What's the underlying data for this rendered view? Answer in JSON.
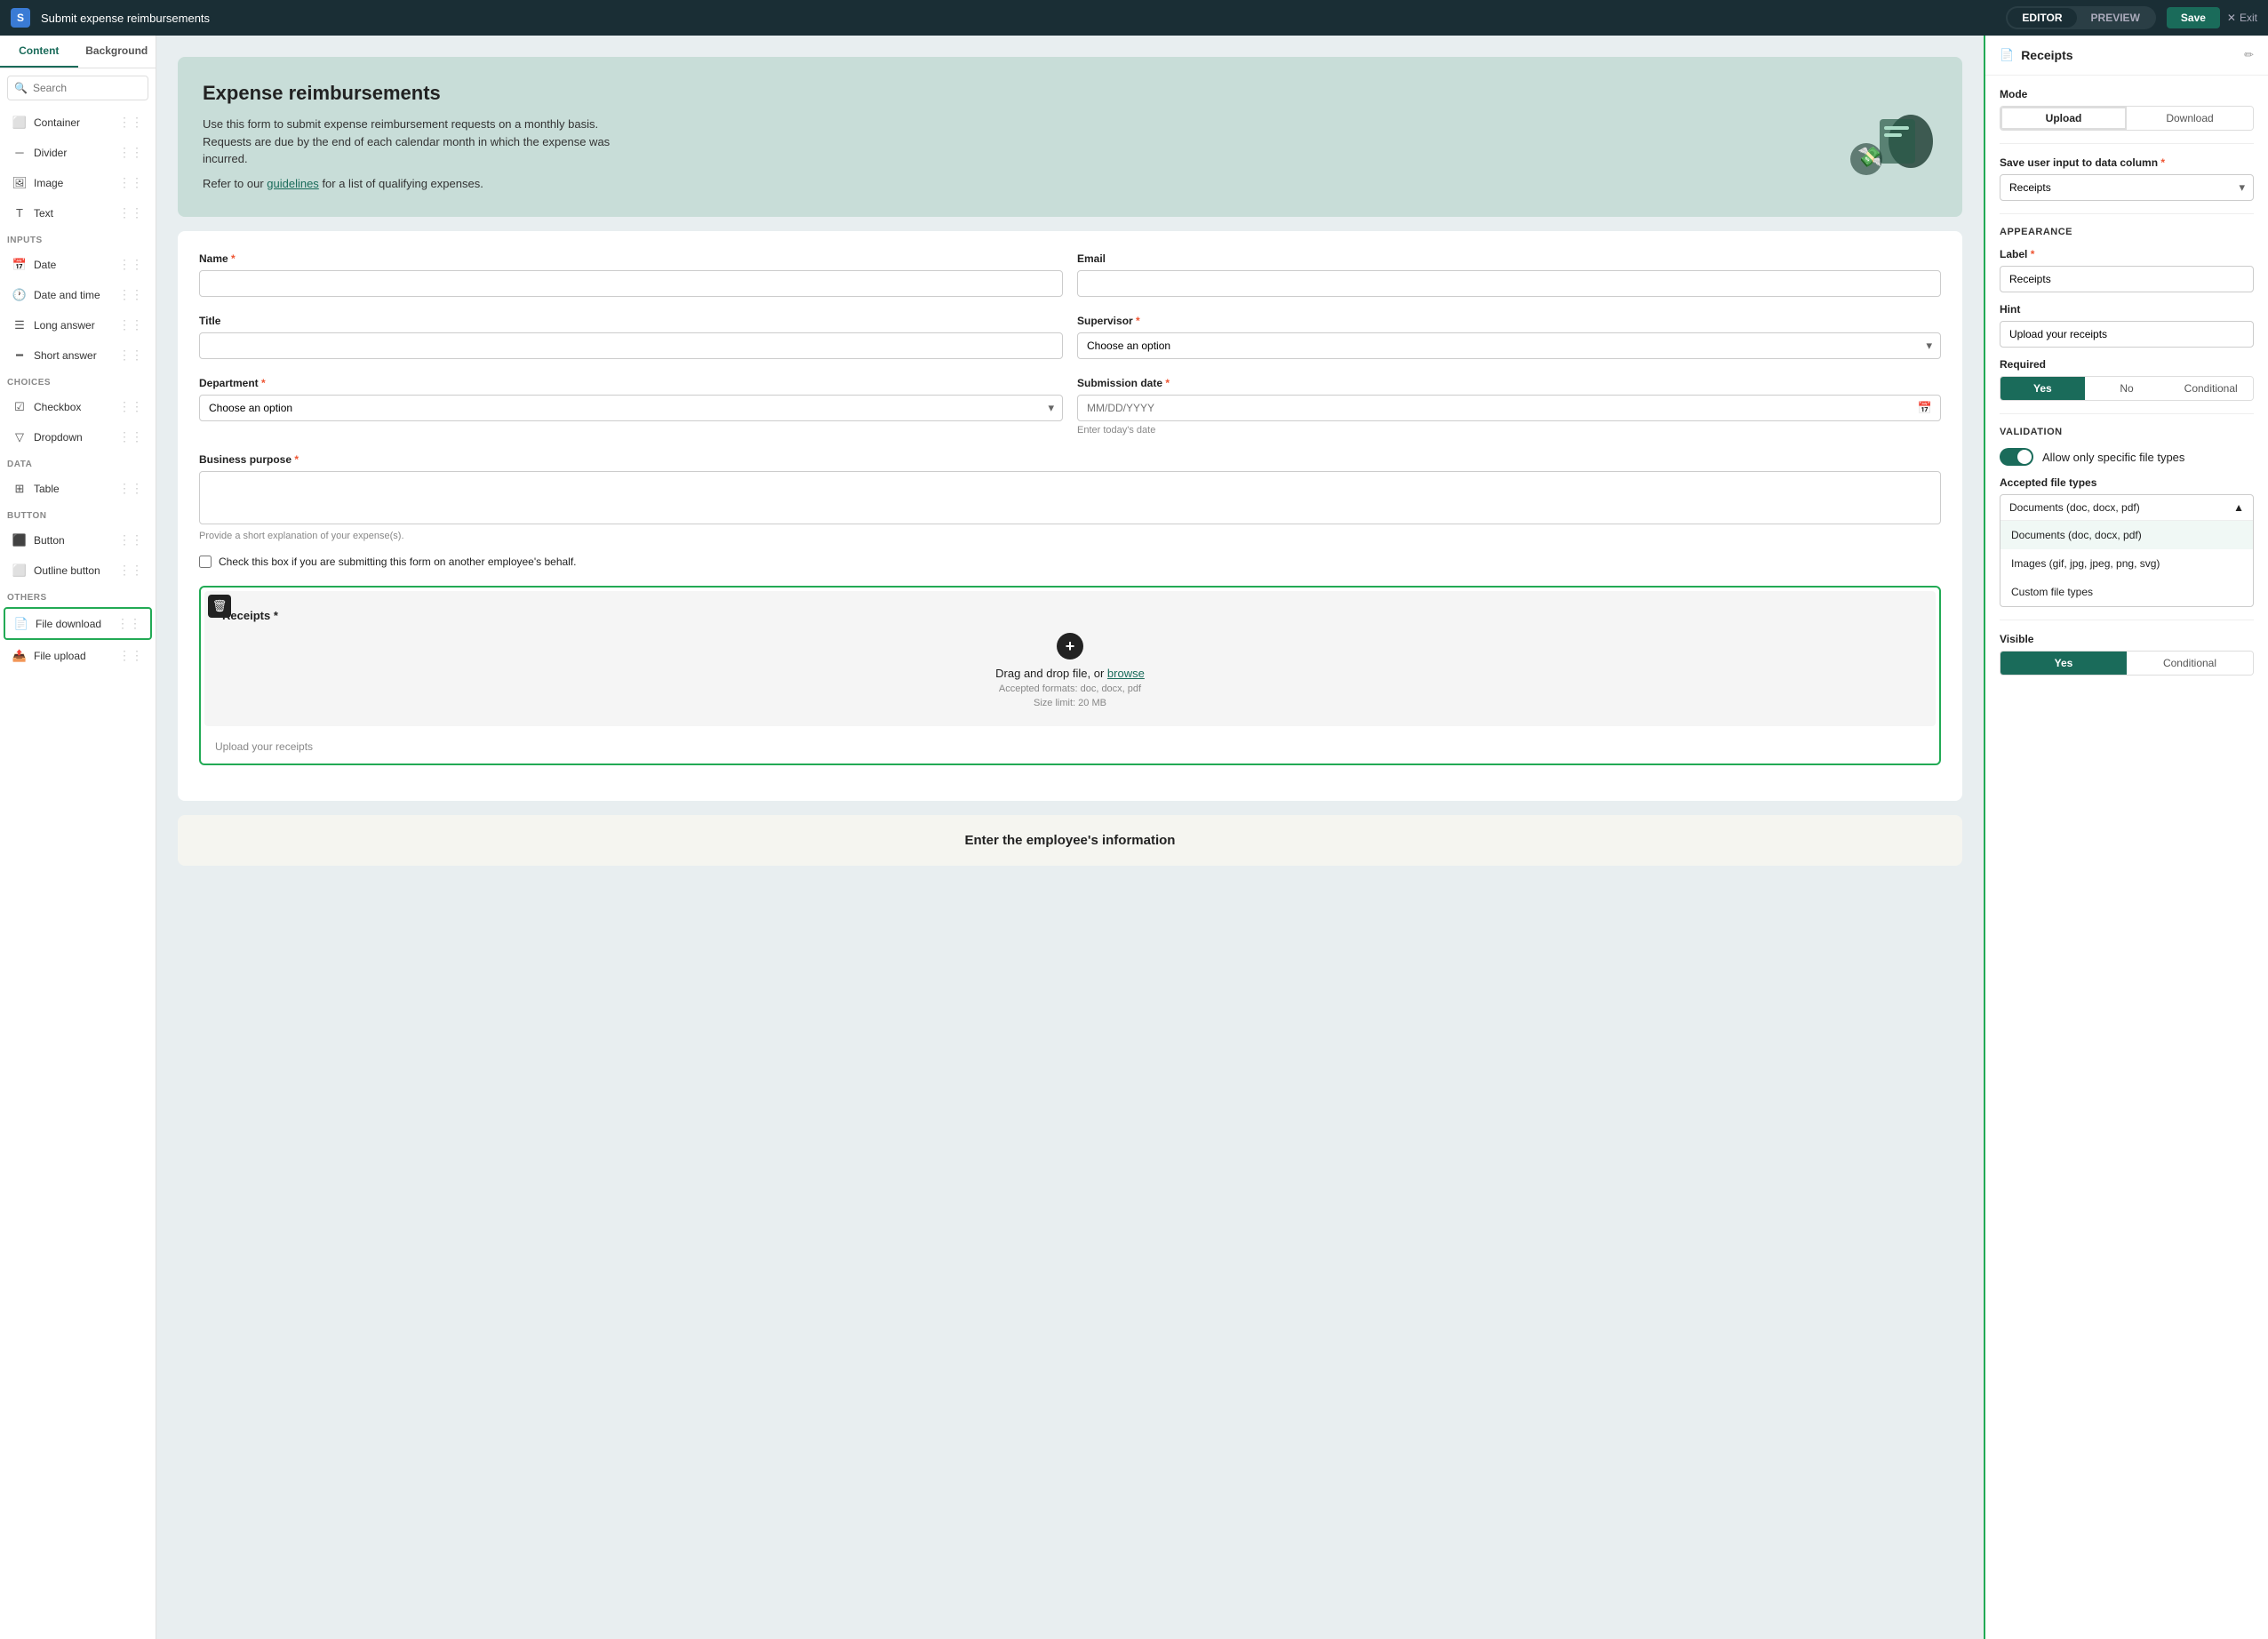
{
  "topbar": {
    "logo_text": "S",
    "title": "Submit expense reimbursements",
    "tabs": [
      {
        "label": "EDITOR",
        "active": true
      },
      {
        "label": "PREVIEW",
        "active": false
      }
    ],
    "save_label": "Save",
    "exit_label": "Exit"
  },
  "sidebar": {
    "tabs": [
      {
        "label": "Content",
        "active": true
      },
      {
        "label": "Background",
        "active": false
      }
    ],
    "search_placeholder": "Search",
    "sections": [
      {
        "label": "",
        "items": [
          {
            "icon": "container",
            "label": "Container"
          },
          {
            "icon": "divider",
            "label": "Divider"
          },
          {
            "icon": "image",
            "label": "Image"
          },
          {
            "icon": "text",
            "label": "Text"
          }
        ]
      },
      {
        "label": "INPUTS",
        "items": [
          {
            "icon": "date",
            "label": "Date"
          },
          {
            "icon": "date-time",
            "label": "Date and time"
          },
          {
            "icon": "long-answer",
            "label": "Long answer"
          },
          {
            "icon": "short-answer",
            "label": "Short answer"
          }
        ]
      },
      {
        "label": "CHOICES",
        "items": [
          {
            "icon": "checkbox",
            "label": "Checkbox"
          },
          {
            "icon": "dropdown",
            "label": "Dropdown"
          }
        ]
      },
      {
        "label": "DATA",
        "items": [
          {
            "icon": "table",
            "label": "Table"
          }
        ]
      },
      {
        "label": "BUTTON",
        "items": [
          {
            "icon": "button",
            "label": "Button"
          },
          {
            "icon": "outline-button",
            "label": "Outline button"
          }
        ]
      },
      {
        "label": "OTHERS",
        "items": [
          {
            "icon": "file-download",
            "label": "File download",
            "highlighted": true
          },
          {
            "icon": "file-upload",
            "label": "File upload"
          }
        ]
      }
    ]
  },
  "form": {
    "header_title": "Expense reimbursements",
    "header_desc1": "Use this form to submit expense reimbursement requests on a monthly basis.",
    "header_desc2": "Requests are due by the end of each calendar month in which the expense was incurred.",
    "header_link_text": "guidelines",
    "header_link_suffix": "for a list of qualifying expenses.",
    "header_link_prefix": "Refer to our ",
    "fields": {
      "name_label": "Name",
      "email_label": "Email",
      "title_label": "Title",
      "supervisor_label": "Supervisor",
      "supervisor_placeholder": "Choose an option",
      "department_label": "Department",
      "department_placeholder": "Choose an option",
      "submission_date_label": "Submission date",
      "submission_date_placeholder": "MM/DD/YYYY",
      "submission_date_hint": "Enter today's date",
      "business_purpose_label": "Business purpose",
      "business_purpose_hint": "Provide a short explanation of your expense(s).",
      "checkbox_label": "Check this box if you are submitting this form on another employee's behalf."
    },
    "receipts": {
      "label": "Receipts",
      "upload_text": "Drag and drop file, or",
      "browse_text": "browse",
      "formats": "Accepted formats: doc, docx, pdf",
      "size_limit": "Size limit: 20 MB",
      "hint": "Upload your receipts"
    },
    "bottom_title": "Enter the employee's information"
  },
  "right_panel": {
    "title": "Receipts",
    "mode_section": "Mode",
    "mode_upload": "Upload",
    "mode_download": "Download",
    "save_col_label": "Save user input to data column",
    "save_col_req": true,
    "save_col_value": "Receipts",
    "appearance_title": "APPEARANCE",
    "label_title": "Label",
    "label_req": true,
    "label_value": "Receipts",
    "hint_title": "Hint",
    "hint_value": "Upload your receipts",
    "required_title": "Required",
    "req_yes": "Yes",
    "req_no": "No",
    "req_conditional": "Conditional",
    "validation_title": "VALIDATION",
    "toggle_label": "Allow only specific file types",
    "file_types_label": "Accepted file types",
    "file_types_selected": "Documents (doc, docx, pdf)",
    "file_type_options": [
      {
        "label": "Documents (doc, docx, pdf)",
        "selected": true
      },
      {
        "label": "Images (gif, jpg, jpeg, png, svg)",
        "selected": false
      },
      {
        "label": "Custom file types",
        "selected": false
      }
    ],
    "visible_title": "Visible",
    "vis_yes": "Yes",
    "vis_conditional": "Conditional"
  }
}
